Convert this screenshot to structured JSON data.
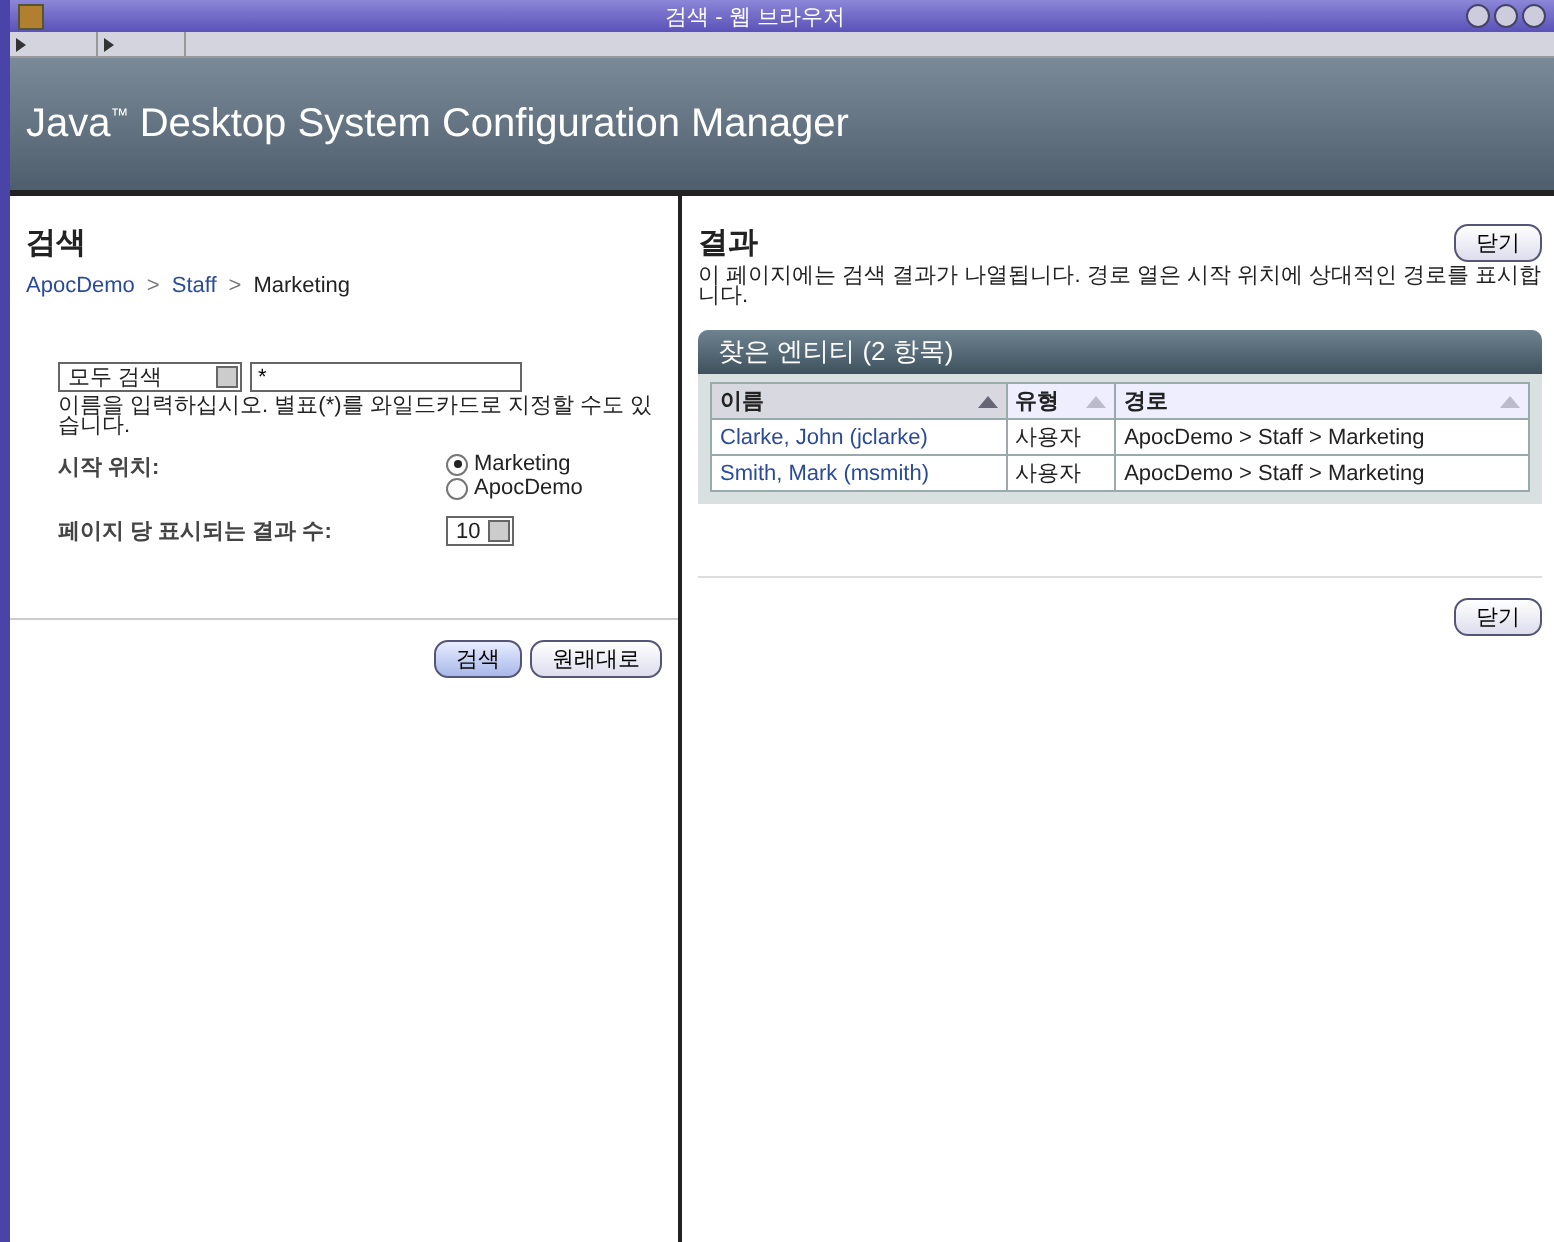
{
  "window": {
    "title": "검색 - 웹 브라우저"
  },
  "banner": {
    "title": "Java",
    "trademark": "™",
    "subtitle": "Desktop System Configuration Manager"
  },
  "search_panel": {
    "title": "검색",
    "breadcrumb": [
      {
        "kind": "link",
        "label": "ApocDemo"
      },
      {
        "kind": "separator",
        "label": ">"
      },
      {
        "kind": "link",
        "label": "Staff"
      },
      {
        "kind": "separator",
        "label": ">"
      },
      {
        "kind": "text",
        "label": "Marketing"
      }
    ],
    "scope_select": {
      "value": "모두 검색"
    },
    "name_field": {
      "value": "*"
    },
    "hint": "이름을 입력하십시오. 별표(*)를 와일드카드로 지정할 수도 있습니다.",
    "start_label": "시작 위치:",
    "start_options": [
      {
        "label": "Marketing",
        "selected": true
      },
      {
        "label": "ApocDemo",
        "selected": false
      }
    ],
    "per_page_label": "페이지 당 표시되는 결과 수:",
    "per_page_select": {
      "value": "10"
    },
    "buttons": [
      {
        "label": "검색",
        "primary": true
      },
      {
        "label": "원래대로",
        "primary": false
      }
    ]
  },
  "results_panel": {
    "title": "결과",
    "close_top": "닫기",
    "description": "이 페이지에는 검색 결과가 나열됩니다. 경로 열은 시작 위치에 상대적인 경로를 표시합니다.",
    "table": {
      "title": "찾은 엔티티 (2 항목)",
      "columns": [
        {
          "label": "이름",
          "sorted": true
        },
        {
          "label": "유형",
          "sorted": false
        },
        {
          "label": "경로",
          "sorted": false
        }
      ],
      "rows": [
        {
          "name": "Clarke, John (jclarke)",
          "type": "사용자",
          "path": "ApocDemo > Staff > Marketing"
        },
        {
          "name": "Smith, Mark (msmith)",
          "type": "사용자",
          "path": "ApocDemo > Staff > Marketing"
        }
      ]
    },
    "close_bottom": "닫기"
  }
}
